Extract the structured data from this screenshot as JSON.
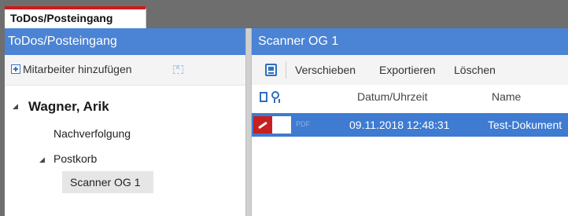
{
  "tab": {
    "title": "ToDos/Posteingang"
  },
  "left_pane": {
    "header": "ToDos/Posteingang",
    "add_employee_label": "Mitarbeiter hinzufügen",
    "tree": {
      "user": "Wagner, Arik",
      "tracking": "Nachverfolgung",
      "inbox": "Postkorb",
      "scanner": "Scanner OG 1"
    }
  },
  "right_pane": {
    "header": "Scanner OG 1",
    "toolbar": {
      "move": "Verschieben",
      "export": "Exportieren",
      "delete": "Löschen"
    },
    "columns": {
      "datetime": "Datum/Uhrzeit",
      "name": "Name"
    },
    "rows": [
      {
        "type_label": "PDF",
        "datetime": "09.11.2018 12:48:31",
        "name": "Test-Dokument"
      }
    ]
  },
  "icons": [
    "plus-icon",
    "remove-icon",
    "scan-icon",
    "page-icon",
    "badge-icon",
    "pdf-icon"
  ],
  "colors": {
    "tab_accent": "#cf1a1a",
    "header_blue": "#4b83d5",
    "selection_blue": "#3e7bd1"
  }
}
